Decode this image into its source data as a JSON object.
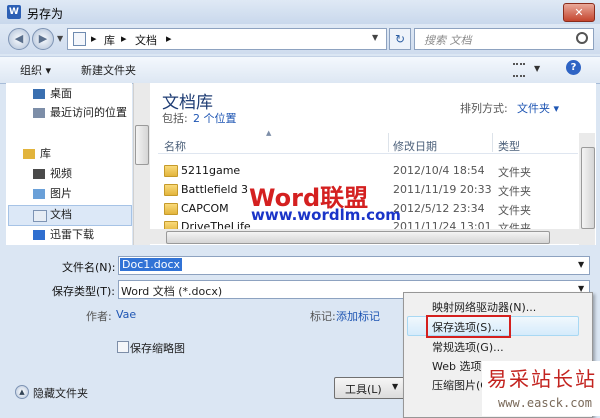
{
  "window": {
    "title": "另存为",
    "app_icon": "W",
    "close_label": "✕"
  },
  "address": {
    "crumbs": [
      "库",
      "文档"
    ],
    "separator": "▸",
    "search_placeholder": "搜索 文档"
  },
  "toolbar": {
    "organize": "组织 ▾",
    "new_folder": "新建文件夹",
    "help": "?"
  },
  "sidebar": {
    "items": [
      {
        "label": "桌面",
        "icon": "desktop-icon"
      },
      {
        "label": "最近访问的位置",
        "icon": "recent-places-icon"
      },
      {
        "label": "库",
        "icon": "library-icon"
      },
      {
        "label": "视频",
        "icon": "video-icon"
      },
      {
        "label": "图片",
        "icon": "pictures-icon"
      },
      {
        "label": "文档",
        "icon": "documents-icon"
      },
      {
        "label": "迅雷下载",
        "icon": "thunder-download-icon"
      }
    ]
  },
  "library": {
    "title": "文档库",
    "includes_label": "包括:",
    "includes_link": "2 个位置",
    "arrange_label": "排列方式:",
    "arrange_value": "文件夹 ▾"
  },
  "columns": {
    "name": "名称",
    "modified": "修改日期",
    "type": "类型"
  },
  "files": [
    {
      "name": "5211game",
      "date": "2012/10/4 18:54",
      "type": "文件夹"
    },
    {
      "name": "Battlefield 3",
      "date": "2011/11/19 20:33",
      "type": "文件夹"
    },
    {
      "name": "CAPCOM",
      "date": "2012/5/12 23:34",
      "type": "文件夹"
    },
    {
      "name": "DriveTheLife",
      "date": "2011/11/24 13:01",
      "type": "文件夹"
    }
  ],
  "form": {
    "filename_label": "文件名(N):",
    "filename_value": "Doc1.docx",
    "filetype_label": "保存类型(T):",
    "filetype_value": "Word 文档 (*.docx)",
    "author_label": "作者:",
    "author_value": "Vae",
    "tags_label": "标记:",
    "tags_value": "添加标记",
    "thumbnail_label": "保存缩略图",
    "hide_folders": "隐藏文件夹",
    "tools": "工具(L)"
  },
  "menu": {
    "items": [
      "映射网络驱动器(N)...",
      "保存选项(S)...",
      "常规选项(G)...",
      "Web 选项",
      "压缩图片(C)"
    ]
  },
  "watermarks": {
    "word_brand": "Word联盟",
    "word_url": "www.wordlm.com",
    "site_cn": "易采站长站",
    "site_url": "www.easck.com"
  },
  "colors": {
    "link": "#1e55b3",
    "title_blue": "#1f3d74",
    "highlight_red": "#d4201e"
  }
}
